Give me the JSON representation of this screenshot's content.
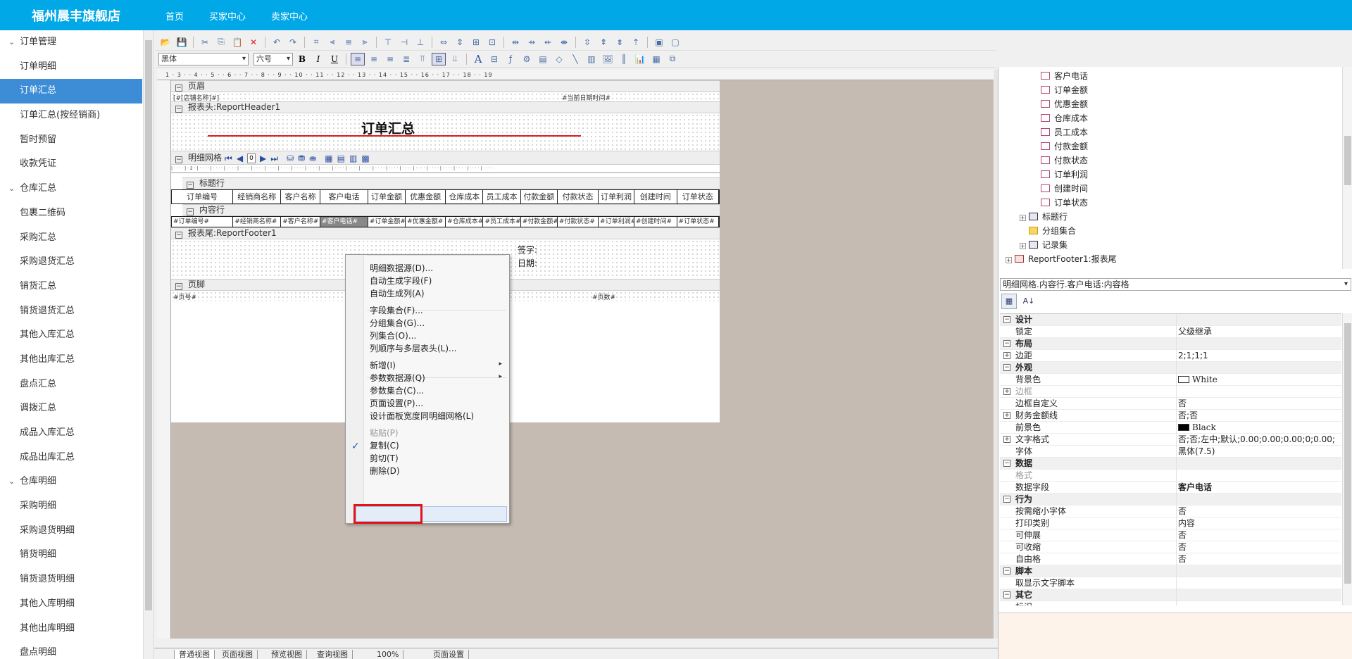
{
  "header": {
    "brand": "福州晨丰旗舰店",
    "nav": [
      "首页",
      "买家中心",
      "卖家中心"
    ]
  },
  "sidebar": {
    "items": [
      {
        "label": "订单管理",
        "group": true
      },
      {
        "label": "订单明细"
      },
      {
        "label": "订单汇总",
        "active": true
      },
      {
        "label": "订单汇总(按经销商)"
      },
      {
        "label": "暂时预留"
      },
      {
        "label": "收款凭证"
      },
      {
        "label": "仓库汇总",
        "group": true
      },
      {
        "label": "包裹二维码"
      },
      {
        "label": "采购汇总"
      },
      {
        "label": "采购退货汇总"
      },
      {
        "label": "销货汇总"
      },
      {
        "label": "销货退货汇总"
      },
      {
        "label": "其他入库汇总"
      },
      {
        "label": "其他出库汇总"
      },
      {
        "label": "盘点汇总"
      },
      {
        "label": "调拨汇总"
      },
      {
        "label": "成品入库汇总"
      },
      {
        "label": "成品出库汇总"
      },
      {
        "label": "仓库明细",
        "group": true
      },
      {
        "label": "采购明细"
      },
      {
        "label": "采购退货明细"
      },
      {
        "label": "销货明细"
      },
      {
        "label": "销货退货明细"
      },
      {
        "label": "其他入库明细"
      },
      {
        "label": "其他出库明细"
      },
      {
        "label": "盘点明细"
      }
    ]
  },
  "toolbar": {
    "font_name": "黑体",
    "font_size": "六号",
    "bold": "B",
    "italic": "I",
    "underline": "U",
    "text_tool": "A"
  },
  "ruler": {
    "top_marks": "1 · 3 · · 4 · · 5 · · 6 · · 7 · · 8 · · 9 · · 10 · · 11 · · 12 · · 13 · · 14 · · 15 · · 16 · · 17 · · 18 · · 19"
  },
  "report": {
    "page_header_title": "页眉",
    "store_field": "[#[店铺名称]#]",
    "current_date_field": "#当前日期时间#",
    "report_header_title": "报表头:ReportHeader1",
    "report_title": "订单汇总",
    "detail_grid_title": "明细网格",
    "page_input": "0",
    "title_row_title": "标题行",
    "columns": [
      "订单编号",
      "经销商名称",
      "客户名称",
      "客户电话",
      "订单金额",
      "优惠金额",
      "仓库成本",
      "员工成本",
      "付款金额",
      "付款状态",
      "订单利润",
      "创建时间",
      "订单状态"
    ],
    "content_row_title": "内容行",
    "content_cells": [
      "#订单编号#",
      "#经销商名称#",
      "#客户名称#",
      "#客户电话#",
      "#订单金额#",
      "#优惠金额#",
      "#仓库成本#",
      "#员工成本#",
      "#付款金额#",
      "#付款状态#",
      "#订单利润#",
      "#创建时间#",
      "#订单状态#"
    ],
    "report_footer_title": "报表尾:ReportFooter1",
    "sign_label": "签字:",
    "date_label": "日期:",
    "page_footer_title": "页脚",
    "page_no_field": "#页号#",
    "page_count_field": "#页数#"
  },
  "context_menu": {
    "items": [
      {
        "label": "明细数据源(D)..."
      },
      {
        "label": "自动生成字段(F)"
      },
      {
        "label": "自动生成列(A)"
      },
      {
        "label": "字段集合(F)..."
      },
      {
        "label": "分组集合(G)..."
      },
      {
        "label": "列集合(O)..."
      },
      {
        "label": "列顺序与多层表头(L)..."
      },
      {
        "label": "新增(I)",
        "submenu": true
      },
      {
        "label": "参数数据源(Q)",
        "submenu": true
      },
      {
        "label": "参数集合(C)..."
      },
      {
        "label": "页面设置(P)..."
      },
      {
        "label": "设计面板宽度同明细网格(L)",
        "checked": true
      },
      {
        "label": "粘贴(P)",
        "disabled": true
      },
      {
        "label": "复制(C)"
      },
      {
        "label": "剪切(T)"
      },
      {
        "label": "删除(D)",
        "highlighted": true
      }
    ],
    "check": "✓",
    "arrow": "▸"
  },
  "tree": {
    "items": [
      {
        "label": "客户电话",
        "icon": "field"
      },
      {
        "label": "订单金额",
        "icon": "field"
      },
      {
        "label": "优惠金额",
        "icon": "field"
      },
      {
        "label": "仓库成本",
        "icon": "field"
      },
      {
        "label": "员工成本",
        "icon": "field"
      },
      {
        "label": "付款金额",
        "icon": "field"
      },
      {
        "label": "付款状态",
        "icon": "field"
      },
      {
        "label": "订单利润",
        "icon": "field"
      },
      {
        "label": "创建时间",
        "icon": "field"
      },
      {
        "label": "订单状态",
        "icon": "field"
      },
      {
        "label": "标题行",
        "icon": "table"
      },
      {
        "label": "分组集合",
        "icon": "folder"
      },
      {
        "label": "记录集",
        "icon": "table"
      },
      {
        "label": "ReportFooter1:报表尾",
        "icon": "report"
      }
    ]
  },
  "properties": {
    "object_selector": "明细网格.内容行.客户电话:内容格",
    "sort_btn_categorized": "▦",
    "sort_btn_alpha": "A↓",
    "rows": [
      {
        "name": "设计",
        "cat": true
      },
      {
        "name": "锁定",
        "value": "父级继承"
      },
      {
        "name": "布局",
        "cat": true
      },
      {
        "name": "边距",
        "value": "2;1;1;1",
        "expand": true
      },
      {
        "name": "外观",
        "cat": true
      },
      {
        "name": "背景色",
        "value": "White",
        "swatch": "#ffffff"
      },
      {
        "name": "边框",
        "value": "",
        "expand": true,
        "disabled": true
      },
      {
        "name": "边框自定义",
        "value": "否"
      },
      {
        "name": "财务金额线",
        "value": "否;否",
        "expand": true
      },
      {
        "name": "前景色",
        "value": "Black",
        "swatch": "#000000"
      },
      {
        "name": "文字格式",
        "value": "否;否;左中;默认;0.00;0.00;0.00;0;0.00;",
        "expand": true
      },
      {
        "name": "字体",
        "value": "黑体(7.5)"
      },
      {
        "name": "数据",
        "cat": true
      },
      {
        "name": "格式",
        "value": "",
        "disabled": true
      },
      {
        "name": "数据字段",
        "value": "客户电话",
        "bold": true
      },
      {
        "name": "行为",
        "cat": true
      },
      {
        "name": "按需缩小字体",
        "value": "否"
      },
      {
        "name": "打印类别",
        "value": "内容"
      },
      {
        "name": "可伸展",
        "value": "否"
      },
      {
        "name": "可收缩",
        "value": "否"
      },
      {
        "name": "自由格",
        "value": "否"
      },
      {
        "name": "脚本",
        "cat": true
      },
      {
        "name": "取显示文字脚本",
        "value": ""
      },
      {
        "name": "其它",
        "cat": true
      },
      {
        "name": "标识",
        "value": ""
      }
    ]
  },
  "bottom_tabs": [
    "普通视图",
    "页面视图",
    "预览视图",
    "查询视图",
    "100%",
    "页面设置"
  ]
}
